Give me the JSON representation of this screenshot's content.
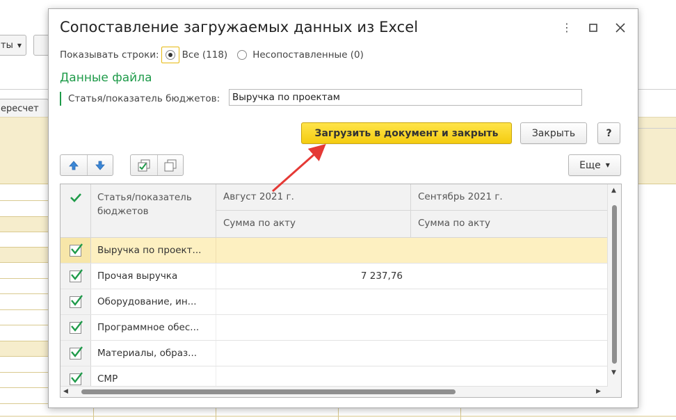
{
  "background": {
    "left_button_label": "ты",
    "recalc_button_label": "ересчет"
  },
  "dialog": {
    "title": "Сопоставление загружаемых данных из Excel",
    "show_rows_label": "Показывать строки:",
    "radio_all_label": "Все (118)",
    "radio_unmatched_label": "Несопоставленные (0)",
    "section_title": "Данные файла",
    "field_label": "Статья/показатель бюджетов:",
    "field_value": "Выручка по проектам",
    "load_button_label": "Загрузить в документ и закрыть",
    "close_button_label": "Закрыть",
    "help_button_label": "?",
    "more_button_label": "Еще"
  },
  "table": {
    "col_name_header": "Статья/показатель бюджетов",
    "col_aug_header": "Август 2021 г.",
    "col_sep_header": "Сентябрь 2021 г.",
    "sub_header_aug": "Сумма по акту",
    "sub_header_sep": "Сумма по акту",
    "rows": [
      {
        "name": "Выручка по проект...",
        "aug": "",
        "sep": ""
      },
      {
        "name": "Прочая выручка",
        "aug": "7 237,76",
        "sep": ""
      },
      {
        "name": "Оборудование, ин...",
        "aug": "",
        "sep": ""
      },
      {
        "name": "Программное обес...",
        "aug": "",
        "sep": ""
      },
      {
        "name": "Материалы, образ...",
        "aug": "",
        "sep": ""
      },
      {
        "name": "СМР",
        "aug": "",
        "sep": ""
      }
    ]
  },
  "colors": {
    "accent_green": "#1f9b4a",
    "primary_button": "#f4cc10",
    "selected_row": "#fdf0c1",
    "annotation_arrow": "#e53935"
  }
}
